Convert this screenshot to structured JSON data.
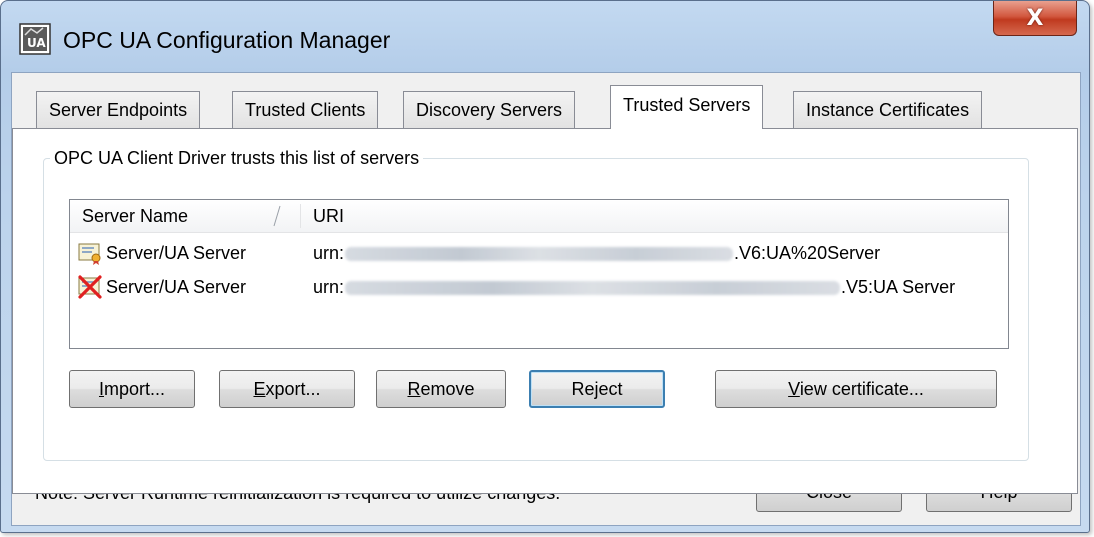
{
  "window": {
    "title": "OPC UA Configuration Manager",
    "close_glyph": "X"
  },
  "tabs": [
    {
      "label": "Server Endpoints"
    },
    {
      "label": "Trusted Clients"
    },
    {
      "label": "Discovery Servers"
    },
    {
      "label": "Trusted Servers"
    },
    {
      "label": "Instance Certificates"
    }
  ],
  "group": {
    "legend": "OPC UA Client Driver trusts this list of servers"
  },
  "list": {
    "columns": {
      "name": "Server Name",
      "uri": "URI"
    },
    "rows": [
      {
        "name": "Server/UA Server",
        "uri_prefix": "urn:",
        "uri_suffix": ".V6:UA%20Server",
        "icon": "certificate-trusted-icon"
      },
      {
        "name": "Server/UA Server",
        "uri_prefix": "urn:",
        "uri_suffix": ".V5:UA Server",
        "icon": "certificate-rejected-icon"
      }
    ]
  },
  "buttons": {
    "import": {
      "underlined": "I",
      "rest": "mport..."
    },
    "export": {
      "underlined": "E",
      "rest": "xport..."
    },
    "remove": {
      "underlined": "R",
      "rest": "emove"
    },
    "reject": {
      "label": "Reject"
    },
    "view_cert": {
      "underlined": "V",
      "rest": "iew certificate..."
    },
    "close": {
      "label": "Close"
    },
    "help": {
      "label": "Help"
    }
  },
  "footer": {
    "note": "Note: Server Runtime reinitialization is required to utilize changes."
  },
  "colors": {
    "title_bar": "#bcd3ec",
    "close_button": "#c03a1f",
    "default_button_border": "#3c7fb1"
  }
}
